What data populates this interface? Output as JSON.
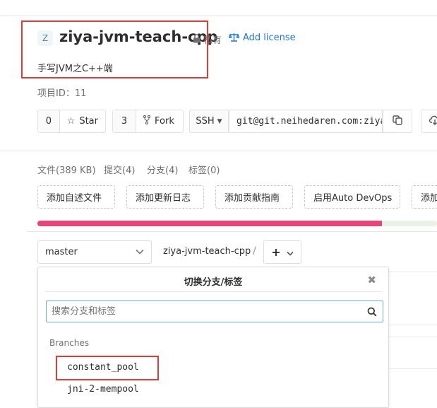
{
  "header": {
    "avatar_letter": "Z",
    "title": "ziya-jvm-teach-cpp",
    "visibility": "私有",
    "license_link": "Add license",
    "description": "手写JVM之C++端",
    "project_id": "项目ID：11"
  },
  "actions": {
    "star_count": "0",
    "star_label": "Star",
    "fork_count": "3",
    "fork_label": "Fork",
    "protocol": "SSH",
    "clone_url": "git@git.neihedaren.com:ziya/ziya-jvm-teach-cpp.git"
  },
  "stats": {
    "files": "文件(389 KB)",
    "commits": "提交(4)",
    "branches": "分支(4)",
    "tags": "标签(0)"
  },
  "quick_actions": [
    "添加自述文件",
    "添加更新日志",
    "添加贡献指南",
    "启用Auto DevOps",
    "添加"
  ],
  "language_bar": {
    "primary_fraction": 0.862,
    "primary_color": "#e8467a",
    "rest_color": "#eaf1e6"
  },
  "repo_nav": {
    "branch": "master",
    "path": "ziya-jvm-teach-cpp",
    "separator": "/",
    "add_label": "+"
  },
  "branch_dropdown": {
    "title": "切换分支/标签",
    "search_placeholder": "搜索分支和标签",
    "section": "Branches",
    "branches": [
      "constant_pool",
      "jni-2-mempool"
    ]
  },
  "colors": {
    "link": "#1f78d1",
    "annotation": "#e03a3a"
  }
}
